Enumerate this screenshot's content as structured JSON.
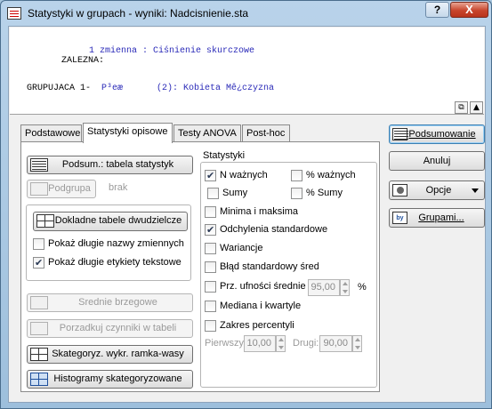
{
  "window": {
    "title": "Statystyki w grupach - wyniki: Nadcisnienie.sta",
    "help_label": "?",
    "close_label": "X"
  },
  "summary": {
    "line1_label": "ZALEZNA:",
    "line1_value": "1 zmienna : Ciśnienie skurczowe",
    "line2_label": "GRUPUJACA 1-",
    "line2_value1": "P³eæ",
    "line2_value2": "(2): Kobieta Mê¿czyzna"
  },
  "tabs": [
    "Podstawowe",
    "Statystyki opisowe",
    "Testy ANOVA",
    "Post-hoc"
  ],
  "left": {
    "summary_table_btn": "Podsum.: tabela statystyk",
    "subgroup_btn": "Podgrupa",
    "subgroup_value": "brak",
    "detailed_tables_btn": "Dokladne tabele dwudzielcze",
    "long_var_names": "Pokaż długie nazwy zmiennych",
    "long_text_labels": "Pokaż długie etykiety tekstowe",
    "marginal_means_btn": "Srednie brzegowe",
    "sort_factors_btn": "Porzadkuj czynniki w tabeli",
    "cat_box_btn": "Skategoryz. wykr. ramka-wasy",
    "cat_hist_btn": "Histogramy skategoryzowane"
  },
  "stats": {
    "group_title": "Statystyki",
    "n_valid": "N ważnych",
    "pct_valid": "% ważnych",
    "sums": "Sumy",
    "pct_sums": "% Sumy",
    "min_max": "Minima i maksima",
    "std_dev": "Odchylenia standardowe",
    "variances": "Wariancje",
    "std_err": "Błąd standardowy średniej",
    "conf_mean": "Prz. ufności średnie",
    "conf_value": "95,00",
    "conf_unit": "%",
    "median_quartiles": "Mediana i kwartyle",
    "percentile_range": "Zakres percentyli",
    "first_label": "Pierwszy:",
    "first_value": "10,00",
    "second_label": "Drugi:",
    "second_value": "90,00"
  },
  "side": {
    "summary_btn": "Podsumowanie",
    "cancel_btn": "Anuluj",
    "options_btn": "Opcje",
    "groups_btn": "Grupami..."
  }
}
